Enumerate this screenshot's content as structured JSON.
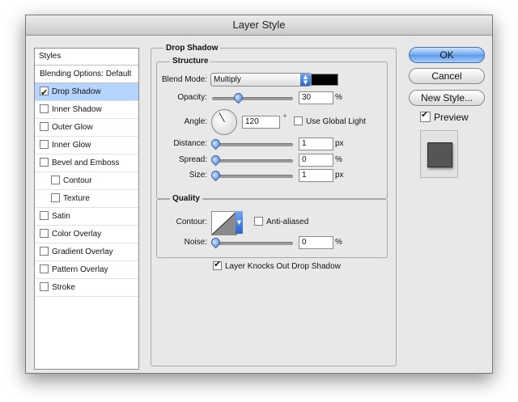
{
  "window": {
    "title": "Layer Style"
  },
  "styles_list": {
    "header": "Styles",
    "blending": "Blending Options: Default",
    "items": [
      {
        "label": "Drop Shadow",
        "checked": true,
        "selected": true,
        "indent": false
      },
      {
        "label": "Inner Shadow",
        "checked": false,
        "selected": false,
        "indent": false
      },
      {
        "label": "Outer Glow",
        "checked": false,
        "selected": false,
        "indent": false
      },
      {
        "label": "Inner Glow",
        "checked": false,
        "selected": false,
        "indent": false
      },
      {
        "label": "Bevel and Emboss",
        "checked": false,
        "selected": false,
        "indent": false
      },
      {
        "label": "Contour",
        "checked": false,
        "selected": false,
        "indent": true
      },
      {
        "label": "Texture",
        "checked": false,
        "selected": false,
        "indent": true
      },
      {
        "label": "Satin",
        "checked": false,
        "selected": false,
        "indent": false
      },
      {
        "label": "Color Overlay",
        "checked": false,
        "selected": false,
        "indent": false
      },
      {
        "label": "Gradient Overlay",
        "checked": false,
        "selected": false,
        "indent": false
      },
      {
        "label": "Pattern Overlay",
        "checked": false,
        "selected": false,
        "indent": false
      },
      {
        "label": "Stroke",
        "checked": false,
        "selected": false,
        "indent": false
      }
    ]
  },
  "drop_shadow": {
    "title": "Drop Shadow",
    "structure": {
      "title": "Structure",
      "blend_mode_label": "Blend Mode:",
      "blend_mode_value": "Multiply",
      "blend_color": "#000000",
      "opacity_label": "Opacity:",
      "opacity_value": "30",
      "opacity_unit": "%",
      "opacity_level": 0.3,
      "angle_label": "Angle:",
      "angle_value": "120",
      "angle_unit": "°",
      "use_global_light_label": "Use Global Light",
      "use_global_light_checked": false,
      "distance_label": "Distance:",
      "distance_value": "1",
      "distance_unit": "px",
      "spread_label": "Spread:",
      "spread_value": "0",
      "spread_unit": "%",
      "size_label": "Size:",
      "size_value": "1",
      "size_unit": "px"
    },
    "quality": {
      "title": "Quality",
      "contour_label": "Contour:",
      "anti_aliased_label": "Anti-aliased",
      "anti_aliased_checked": false,
      "noise_label": "Noise:",
      "noise_value": "0",
      "noise_unit": "%"
    },
    "knockout_label": "Layer Knocks Out Drop Shadow",
    "knockout_checked": true
  },
  "buttons": {
    "ok": "OK",
    "cancel": "Cancel",
    "new_style": "New Style...",
    "preview_label": "Preview",
    "preview_checked": true
  },
  "icons": {
    "select_arrows": "up-down-arrows-icon",
    "contour_arrow": "chevron-down-icon",
    "angle_dial": "angle-dial-icon"
  }
}
